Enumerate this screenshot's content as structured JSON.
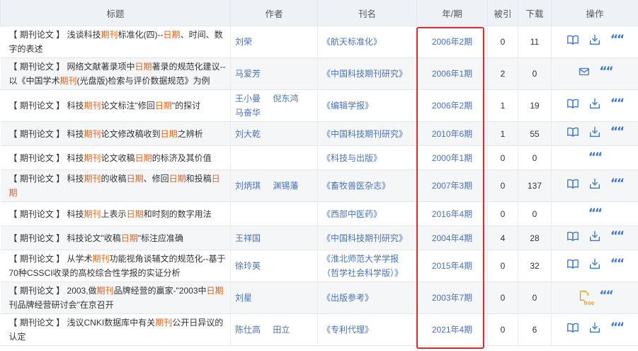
{
  "headers": {
    "title": "标题",
    "author": "作者",
    "journal": "刊名",
    "year": "年/期",
    "cited": "被引",
    "download": "下载",
    "ops": "操作"
  },
  "free_label": "free",
  "colors": {
    "highlight": "#e85d10",
    "link": "#4a73b0",
    "accent": "#3d78c9",
    "redbox": "#e02828"
  },
  "rows": [
    {
      "type": "【 期刊论文 】",
      "segments": [
        {
          "t": "浅谈科技"
        },
        {
          "t": "期刊",
          "h": true
        },
        {
          "t": "标准化(四)--"
        },
        {
          "t": "日期",
          "h": true
        },
        {
          "t": "、时间、数字的表述"
        }
      ],
      "authors": [
        "刘荣"
      ],
      "journal": "《航天标准化》",
      "year": "2006年2期",
      "cited": "0",
      "downloads": "11",
      "ops": [
        "read",
        "download",
        "cite"
      ]
    },
    {
      "type": "【 期刊论文 】",
      "segments": [
        {
          "t": "网络文献著录项中"
        },
        {
          "t": "日期",
          "h": true
        },
        {
          "t": "著录的规范化建议--以《中国学术"
        },
        {
          "t": "期刊",
          "h": true
        },
        {
          "t": "(光盘版)检索与评价数据规范》为例"
        }
      ],
      "authors": [
        "马爱芳"
      ],
      "journal": "《中国科技期刊研究》",
      "year": "2006年1期",
      "cited": "2",
      "downloads": "0",
      "ops": [
        "mail",
        "cite"
      ]
    },
    {
      "type": "【 期刊论文 】",
      "segments": [
        {
          "t": "科技"
        },
        {
          "t": "期刊",
          "h": true
        },
        {
          "t": "论文标注\"修回"
        },
        {
          "t": "日期",
          "h": true
        },
        {
          "t": "\"的探讨"
        }
      ],
      "authors": [
        "王小曼",
        "倪东鸿",
        "马奋华"
      ],
      "journal": "《编辑学报》",
      "year": "2006年2期",
      "cited": "1",
      "downloads": "19",
      "ops": [
        "read",
        "download",
        "cite"
      ]
    },
    {
      "type": "【 期刊论文 】",
      "segments": [
        {
          "t": "科技"
        },
        {
          "t": "期刊",
          "h": true
        },
        {
          "t": "论文修改稿收到"
        },
        {
          "t": "日期",
          "h": true
        },
        {
          "t": "之辨析"
        }
      ],
      "authors": [
        "刘大乾"
      ],
      "journal": "《中国科技期刊研究》",
      "year": "2010年6期",
      "cited": "1",
      "downloads": "55",
      "ops": [
        "read",
        "download",
        "cite"
      ]
    },
    {
      "type": "【 期刊论文 】",
      "segments": [
        {
          "t": "科技"
        },
        {
          "t": "期刊",
          "h": true
        },
        {
          "t": "论文收稿"
        },
        {
          "t": "日期",
          "h": true
        },
        {
          "t": "的标济及其价值"
        }
      ],
      "authors": [],
      "journal": "《科技与出版》",
      "year": "2000年1期",
      "cited": "0",
      "downloads": "0",
      "ops": [
        "cite"
      ]
    },
    {
      "type": "【 期刊论文 】",
      "segments": [
        {
          "t": "科技"
        },
        {
          "t": "期刊",
          "h": true
        },
        {
          "t": "的收稿"
        },
        {
          "t": "日期",
          "h": true
        },
        {
          "t": "、修回"
        },
        {
          "t": "日期",
          "h": true
        },
        {
          "t": "和投稿"
        },
        {
          "t": "日期",
          "h": true
        }
      ],
      "authors": [
        "刘炳琪",
        "渊锡藩"
      ],
      "journal": "《畜牧兽医杂志》",
      "year": "2007年3期",
      "cited": "0",
      "downloads": "137",
      "ops": [
        "read",
        "download",
        "cite"
      ]
    },
    {
      "type": "【 期刊论文 】",
      "segments": [
        {
          "t": "科技"
        },
        {
          "t": "期刊",
          "h": true
        },
        {
          "t": "上表示"
        },
        {
          "t": "日期",
          "h": true
        },
        {
          "t": "和时刻的数字用法"
        }
      ],
      "authors": [],
      "journal": "《西部中医药》",
      "year": "2016年4期",
      "cited": "0",
      "downloads": "0",
      "ops": [
        "cite"
      ]
    },
    {
      "type": "【 期刊论文 】",
      "segments": [
        {
          "t": "科技论文\"收稿"
        },
        {
          "t": "日期",
          "h": true
        },
        {
          "t": "\"标注应准确"
        }
      ],
      "authors": [
        "王祥国"
      ],
      "journal": "《中国科技期刊研究》",
      "year": "2004年4期",
      "cited": "4",
      "downloads": "28",
      "ops": [
        "read",
        "download",
        "cite"
      ]
    },
    {
      "type": "【 期刊论文 】",
      "segments": [
        {
          "t": "从学术"
        },
        {
          "t": "期刊",
          "h": true
        },
        {
          "t": "功能视角谈辅文的规范化--基于70种CSSCI收录的高校综合性学报的实证分析"
        }
      ],
      "authors": [
        "徐玲英"
      ],
      "journal": "《淮北师范大学学报（哲学社会科学版）》",
      "year": "2015年4期",
      "cited": "0",
      "downloads": "32",
      "ops": [
        "read",
        "download",
        "cite"
      ]
    },
    {
      "type": "【 期刊论文 】",
      "segments": [
        {
          "t": "2003,做"
        },
        {
          "t": "期刊",
          "h": true
        },
        {
          "t": "品牌经营的赢家-\"2003中"
        },
        {
          "t": "日期",
          "h": true
        },
        {
          "t": "刊品牌经营研讨会\"在京召开"
        }
      ],
      "authors": [
        "刘星"
      ],
      "journal": "《出版参考》",
      "year": "2003年7期",
      "cited": "0",
      "downloads": "0",
      "ops": [
        "free",
        "cite"
      ]
    },
    {
      "type": "【 期刊论文 】",
      "segments": [
        {
          "t": "浅议CNKI数据库中有关"
        },
        {
          "t": "期刊",
          "h": true
        },
        {
          "t": "公开日异议的认定"
        }
      ],
      "authors": [
        "陈仕高",
        "田立"
      ],
      "journal": "《专利代理》",
      "year": "2021年4期",
      "cited": "0",
      "downloads": "6",
      "ops": [
        "read",
        "download",
        "cite"
      ]
    }
  ]
}
